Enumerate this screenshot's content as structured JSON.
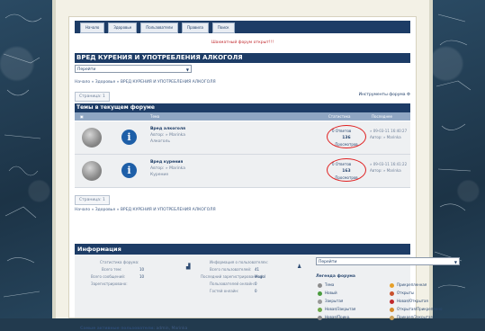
{
  "nav": {
    "items": [
      "Начало",
      "Здоровье",
      "Пользователи",
      "Правила",
      "Поиск"
    ]
  },
  "announcement": "Шахматный форум открыт!!!",
  "forum_title": "ВРЕД КУРЕНИЯ И УПОТРЕБЛЕНИЯ АЛКОГОЛЯ",
  "jump": {
    "value": "Перейти"
  },
  "breadcrumb_top": "Начало » Здоровье » ВРЕД КУРЕНИЯ И УПОТРЕБЛЕНИЯ АЛКОГОЛЯ",
  "breadcrumb_bottom": "Начало » Здоровье » ВРЕД КУРЕНИЯ И УПОТРЕБЛЕНИЯ АЛКОГОЛЯ",
  "pager_label": "Страница: 1",
  "tools_label": "Инструменты форума",
  "topics_header": "Темы в текущем форуме",
  "columns": {
    "topic": "Тема",
    "stats": "Статистика",
    "last": "Последнее сообщение"
  },
  "topics": [
    {
      "title": "Вред алкоголя",
      "author": "Автор: » Marinka",
      "sub": "Алкоголь",
      "answers": "0 Ответов",
      "count": "136",
      "views": "Просмотров",
      "last1": "» 09-03-11 16:40:27",
      "last2": "Автор: » Marinka"
    },
    {
      "title": "Вред курения",
      "author": "Автор: » Marinka",
      "sub": "Курение",
      "answers": "0 Ответов",
      "count": "163",
      "views": "Просмотров",
      "last1": "» 09-03-11 16:41:22",
      "last2": "Автор: » Marinka"
    }
  ],
  "info": {
    "header": "Информация",
    "stats_label": "Статистика форума:",
    "topics_label": "Всего тем:",
    "topics_value": "10",
    "posts_label": "Всего сообщений:",
    "posts_value": "10",
    "registered_label": "Зарегистрировано:",
    "users_label": "Информация о пользователях:",
    "users_total_label": "Всего пользователей:",
    "users_total_value": "41",
    "last_user_label": "Последний зарегистрированный:",
    "last_user_value": "Mogol",
    "users_online_label": "Пользователей онлайн:",
    "users_online_value": "0",
    "guests_label": "Гостей онлайн:",
    "guests_value": "0",
    "themes_select": "Перейти",
    "legend_title": "Легенда форума",
    "legend": [
      {
        "label": "Тема",
        "color": "#8d8d8d"
      },
      {
        "label": "Прикрепленная",
        "color": "#e6a02a"
      },
      {
        "label": "Новый",
        "color": "#4a9b3e"
      },
      {
        "label": "Открыты",
        "color": "#c9512d"
      },
      {
        "label": "Закрытая",
        "color": "#9a9a9a"
      },
      {
        "label": "Новая/Открытая",
        "color": "#c0282d"
      },
      {
        "label": "Новая/Закрытая",
        "color": "#6ea84a"
      },
      {
        "label": "Открытая/Прикреплено",
        "color": "#d58a2a"
      },
      {
        "label": "Новая/Прикр.",
        "color": "#8c8c8c"
      },
      {
        "label": "Прикреп/Закрытая",
        "color": "#c9a05a"
      }
    ],
    "active_label": "Самые активные пользователи:",
    "active_users": "admin, Marinka"
  }
}
